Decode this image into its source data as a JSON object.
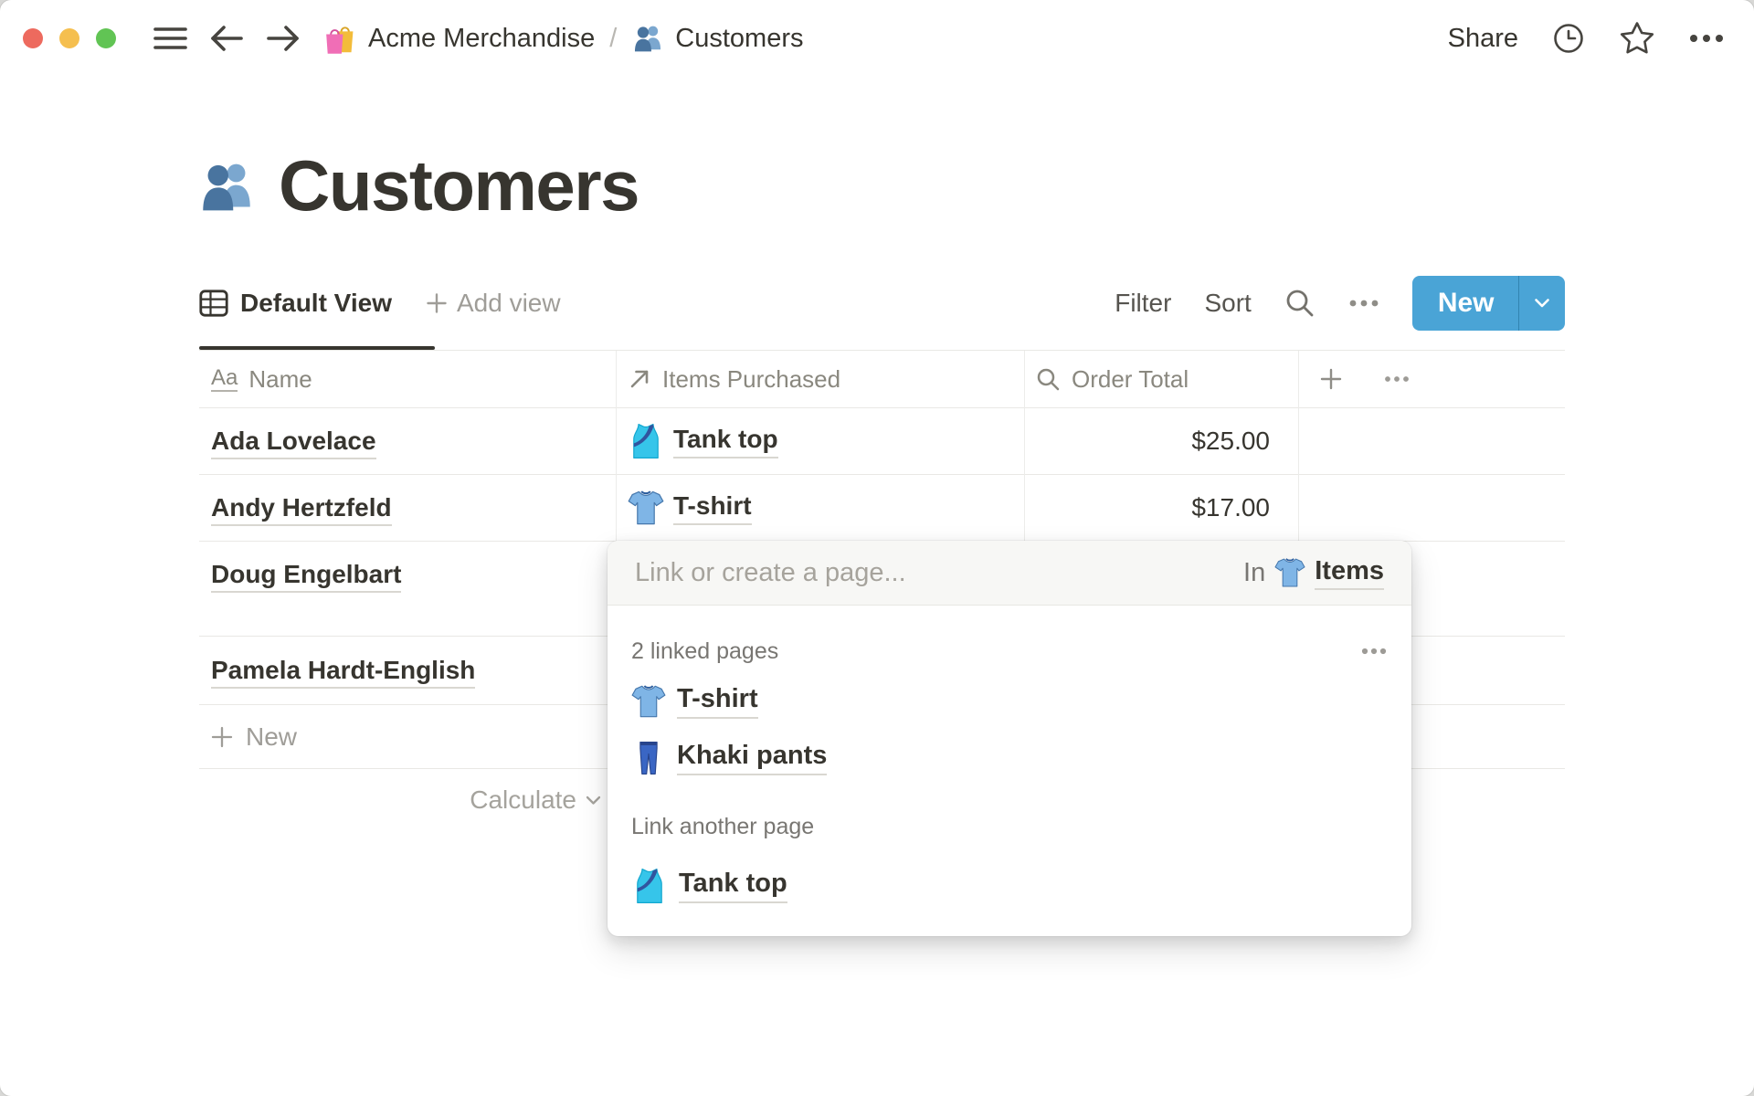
{
  "topbar": {
    "breadcrumb": {
      "workspace_icon": "#sym-shopping-bags",
      "workspace": "Acme Merchandise",
      "separator": "/",
      "page_icon": "#sym-people",
      "page": "Customers"
    },
    "share_label": "Share"
  },
  "page": {
    "title_icon": "#sym-people",
    "title": "Customers"
  },
  "toolbar": {
    "view_label": "Default View",
    "add_view_label": "Add view",
    "filter_label": "Filter",
    "sort_label": "Sort",
    "new_label": "New"
  },
  "table": {
    "columns": [
      {
        "icon": "text-property-icon",
        "label": "Name"
      },
      {
        "icon": "relation-property-icon",
        "label": "Items Purchased"
      },
      {
        "icon": "rollup-property-icon",
        "label": "Order Total"
      }
    ],
    "rows": [
      {
        "name": "Ada Lovelace",
        "item_icon": "#sym-tank-top",
        "item": "Tank top",
        "total": "$25.00"
      },
      {
        "name": "Andy Hertzfeld",
        "item_icon": "#sym-tshirt",
        "item": "T-shirt",
        "total": "$17.00"
      },
      {
        "name": "Doug Engelbart"
      },
      {
        "name": "Pamela Hardt-English"
      }
    ],
    "new_row_label": "New",
    "calculate_label": "Calculate"
  },
  "popup": {
    "search_placeholder": "Link or create a page...",
    "scope_prefix": "In",
    "scope_icon": "#sym-tshirt",
    "scope_name": "Items",
    "linked_section_label": "2 linked pages",
    "linked_pages": [
      {
        "icon": "#sym-tshirt",
        "label": "T-shirt"
      },
      {
        "icon": "#sym-jeans",
        "label": "Khaki pants"
      }
    ],
    "link_another_label": "Link another page",
    "suggestions": [
      {
        "icon": "#sym-tank-top",
        "label": "Tank top"
      }
    ]
  },
  "colors": {
    "accent_blue": "#4AA4D6",
    "text_dark": "#37352f",
    "text_gray": "#787672"
  }
}
